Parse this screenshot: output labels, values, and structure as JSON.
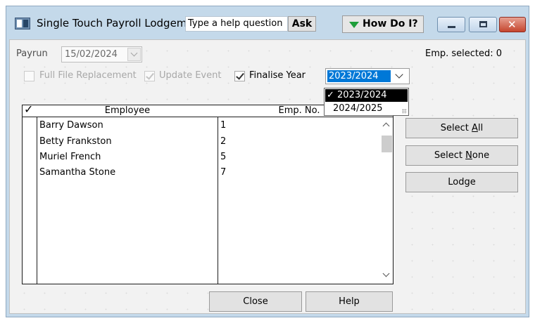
{
  "window": {
    "title": "Single Touch Payroll Lodgement",
    "help_placeholder": "Type a help question",
    "ask_label": "Ask",
    "how_do_i_label": "How Do I?"
  },
  "form": {
    "payrun_label": "Payrun",
    "payrun_value": "15/02/2024",
    "emp_selected_label": "Emp. selected: 0",
    "options": {
      "full_file_replacement": {
        "label": "Full File Replacement",
        "checked": false,
        "enabled": false
      },
      "update_event": {
        "label": "Update Event",
        "checked": true,
        "enabled": false
      },
      "finalise_year": {
        "label": "Finalise Year",
        "checked": true,
        "enabled": true
      }
    },
    "year_select": {
      "value": "2023/2024",
      "options": [
        "✓ 2023/2024",
        "2024/2025"
      ]
    }
  },
  "table": {
    "headers": {
      "check": "✓",
      "employee": "Employee",
      "emp_no": "Emp. No."
    },
    "rows": [
      {
        "employee": "Barry Dawson",
        "emp_no": "1"
      },
      {
        "employee": "Betty Frankston",
        "emp_no": "2"
      },
      {
        "employee": "Muriel French",
        "emp_no": "5"
      },
      {
        "employee": "Samantha Stone",
        "emp_no": "7"
      }
    ]
  },
  "buttons": {
    "select_all": {
      "before": "Select ",
      "accel": "A",
      "after": "ll"
    },
    "select_none": {
      "before": "Select ",
      "accel": "N",
      "after": "one"
    },
    "lodge": "Lodge",
    "close": "Close",
    "help": "Help"
  },
  "colors": {
    "title_bar": "#c4d9ea",
    "selection": "#0078d7",
    "close_button": "#c5462f",
    "how_do_i_arrow": "#1e9e3a"
  }
}
